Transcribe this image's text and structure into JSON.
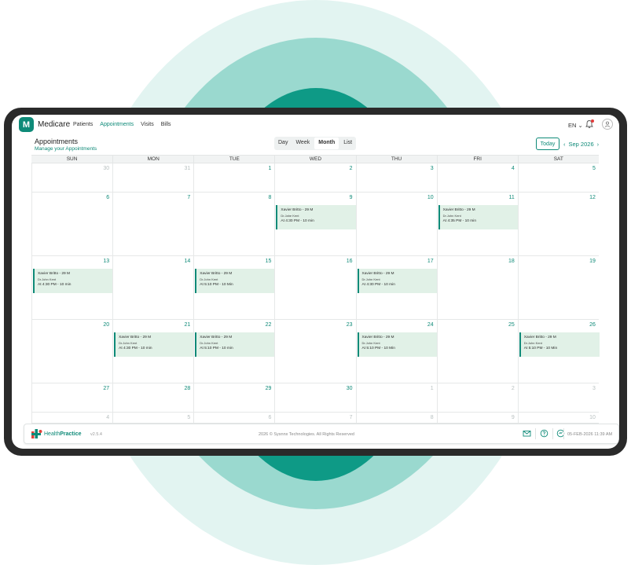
{
  "app": {
    "logo_letter": "M",
    "name": "Medicare",
    "nav": [
      "Patients",
      "Appointments",
      "Visits",
      "Bills"
    ],
    "active_nav": "Appointments",
    "language": "EN",
    "language_chevron": "⌄"
  },
  "header": {
    "title": "Appointments",
    "subtitle": "Manage your Appointments",
    "views": [
      "Day",
      "Week",
      "Month",
      "List"
    ],
    "active_view": "Month",
    "today_label": "Today",
    "prev_icon": "‹",
    "next_icon": "›",
    "month_label": "Sep 2026"
  },
  "calendar": {
    "weekdays": [
      "SUN",
      "MON",
      "TUE",
      "WED",
      "THU",
      "FRI",
      "SAT"
    ],
    "weeks": [
      {
        "days": [
          {
            "n": "30",
            "muted": true
          },
          {
            "n": "31",
            "muted": true
          },
          {
            "n": "1"
          },
          {
            "n": "2"
          },
          {
            "n": "3"
          },
          {
            "n": "4"
          },
          {
            "n": "5"
          }
        ]
      },
      {
        "days": [
          {
            "n": "6"
          },
          {
            "n": "7"
          },
          {
            "n": "8"
          },
          {
            "n": "9",
            "event": {
              "patient": "Xavier Britto - 29 M",
              "doctor": "Dr.Jahe Kent",
              "time": "At 4:30 PM - 10 min"
            }
          },
          {
            "n": "10"
          },
          {
            "n": "11",
            "event": {
              "patient": "Xavier Britto - 29 M",
              "doctor": "Dr.John Kent",
              "time": "At 4:35 PM - 10 min"
            }
          },
          {
            "n": "12"
          }
        ]
      },
      {
        "days": [
          {
            "n": "13",
            "event": {
              "patient": "Xavier Britto - 29 M",
              "doctor": "Dr.John Kent",
              "time": "At 4:30 PM - 10 min"
            }
          },
          {
            "n": "14"
          },
          {
            "n": "15",
            "event": {
              "patient": "Xavier Britto - 29 M",
              "doctor": "Dr.John Kent",
              "time": "At 5:10 PM - 10 Min"
            }
          },
          {
            "n": "16"
          },
          {
            "n": "17",
            "event": {
              "patient": "Xavier Britto - 29 M",
              "doctor": "Dr.John Kent",
              "time": "At 4:30 PM - 10 min"
            }
          },
          {
            "n": "18"
          },
          {
            "n": "19"
          }
        ]
      },
      {
        "days": [
          {
            "n": "20"
          },
          {
            "n": "21",
            "event": {
              "patient": "Xavier Britto - 29 M",
              "doctor": "Dr.John Kent",
              "time": "At 4:30 PM - 10 min"
            }
          },
          {
            "n": "22",
            "event": {
              "patient": "Xavier Britto - 29 M",
              "doctor": "Dr.John Kent",
              "time": "At 5:10 PM - 10 min"
            }
          },
          {
            "n": "23"
          },
          {
            "n": "24",
            "event": {
              "patient": "Xavier Britto - 29 M",
              "doctor": "Dr.John Kent",
              "time": "At 5:10 PM - 10 Min"
            }
          },
          {
            "n": "25"
          },
          {
            "n": "26",
            "event": {
              "patient": "Xavier Britto - 29 M",
              "doctor": "Dr.John Kent",
              "time": "At 5:10 PM - 10 Min"
            }
          }
        ]
      },
      {
        "days": [
          {
            "n": "27"
          },
          {
            "n": "28"
          },
          {
            "n": "29"
          },
          {
            "n": "30"
          },
          {
            "n": "1",
            "muted": true
          },
          {
            "n": "2",
            "muted": true
          },
          {
            "n": "3",
            "muted": true
          }
        ]
      },
      {
        "days": [
          {
            "n": "4",
            "muted": true
          },
          {
            "n": "5",
            "muted": true
          },
          {
            "n": "6",
            "muted": true
          },
          {
            "n": "7",
            "muted": true
          },
          {
            "n": "8",
            "muted": true
          },
          {
            "n": "9",
            "muted": true
          },
          {
            "n": "10",
            "muted": true
          }
        ]
      }
    ]
  },
  "footer": {
    "brand_prefix": "Health",
    "brand_suffix": "Practice",
    "version": "v2.5.4",
    "copyright": "2026 © Sysnnx Technologies. All Rights Reserved",
    "datetime": "05-FEB-2026 11:39 AM"
  },
  "colors": {
    "accent": "#0e8a78",
    "event_bg": "#e1f1e7"
  }
}
